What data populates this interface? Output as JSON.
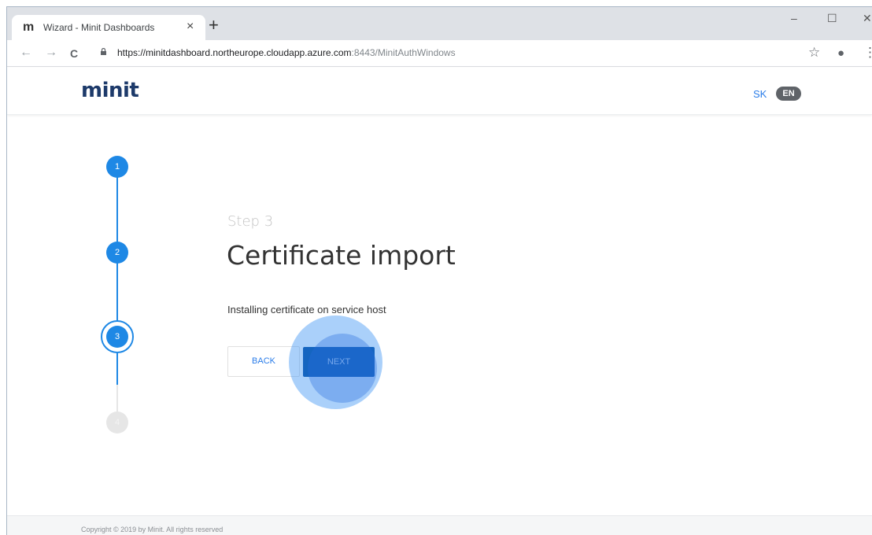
{
  "browser": {
    "tab": {
      "favicon": "m",
      "title": "Wizard - Minit Dashboards",
      "close": "×"
    },
    "new_tab": "+",
    "window_controls": {
      "minimize": "–",
      "maximize": "☐",
      "close": "✕"
    },
    "nav": {
      "back": "←",
      "forward": "→",
      "reload": "C"
    },
    "url": {
      "main": "https://minitdashboard.northeurope.cloudapp.azure.com",
      "rest": ":8443/MinitAuthWindows"
    },
    "toolbar_icons": {
      "bookmark": "☆",
      "profile": "●",
      "menu": "⋮"
    }
  },
  "header": {
    "logo": "minit",
    "languages": [
      {
        "code": "SK",
        "active": false
      },
      {
        "code": "EN",
        "active": true
      }
    ]
  },
  "stepper": {
    "steps": [
      {
        "label": "1",
        "state": "done"
      },
      {
        "label": "2",
        "state": "done"
      },
      {
        "label": "3",
        "state": "active"
      },
      {
        "label": "4",
        "state": "pending"
      }
    ],
    "colors": {
      "done": "#1e88e5",
      "pending": "#e6e6e6"
    }
  },
  "content": {
    "kicker": "Step 3",
    "title": "Certificate import",
    "description": "Installing certificate on service host",
    "back_label": "BACK",
    "next_label": "NEXT"
  },
  "footer": {
    "copyright": "Copyright © 2019 by Minit. All rights reserved"
  }
}
